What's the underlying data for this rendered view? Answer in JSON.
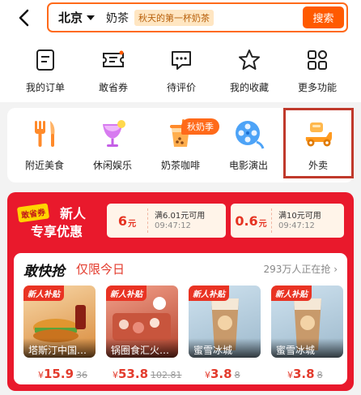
{
  "header": {
    "city": "北京",
    "query": "奶茶",
    "suggest_chip": "秋天的第一杯奶茶",
    "search_button": "搜索"
  },
  "quick_actions": [
    {
      "label": "我的订单",
      "icon": "orders-icon"
    },
    {
      "label": "敢省券",
      "icon": "coupon-icon"
    },
    {
      "label": "待评价",
      "icon": "review-icon"
    },
    {
      "label": "我的收藏",
      "icon": "star-icon"
    },
    {
      "label": "更多功能",
      "icon": "grid-icon"
    }
  ],
  "categories": [
    {
      "label": "附近美食",
      "icon": "fork-knife-icon"
    },
    {
      "label": "休闲娱乐",
      "icon": "cocktail-icon"
    },
    {
      "label": "奶茶咖啡",
      "icon": "milk-tea-icon",
      "tag": "秋奶季"
    },
    {
      "label": "电影演出",
      "icon": "film-reel-icon"
    },
    {
      "label": "外卖",
      "icon": "scooter-icon"
    }
  ],
  "promo": {
    "badge_tag": "敢省券",
    "badge_line1": "新人",
    "badge_line2": "专享优惠",
    "coupons": [
      {
        "amount": "6",
        "unit": "元",
        "condition": "满6.01元可用",
        "time": "09:47:12"
      },
      {
        "amount": "0.6",
        "unit": "元",
        "condition": "满10元可用",
        "time": "09:47:12"
      }
    ],
    "flash": {
      "title": "敢快抢",
      "subtitle": "仅限今日",
      "count": "293万人正在抢",
      "items": [
        {
          "tag": "新人补贴",
          "name": "塔斯汀中国…",
          "price": "15.9",
          "old": "36"
        },
        {
          "tag": "新人补贴",
          "name": "锅圈食汇火…",
          "price": "53.8",
          "old": "102.81"
        },
        {
          "tag": "新人补贴",
          "name": "蜜雪冰城",
          "price": "3.8",
          "old": "8"
        },
        {
          "tag": "新人补贴",
          "name": "蜜雪冰城",
          "price": "3.8",
          "old": "8"
        }
      ]
    }
  },
  "colors": {
    "accent": "#ff5a00",
    "promo_red": "#e9192c",
    "highlight_box": "#c0392b"
  }
}
